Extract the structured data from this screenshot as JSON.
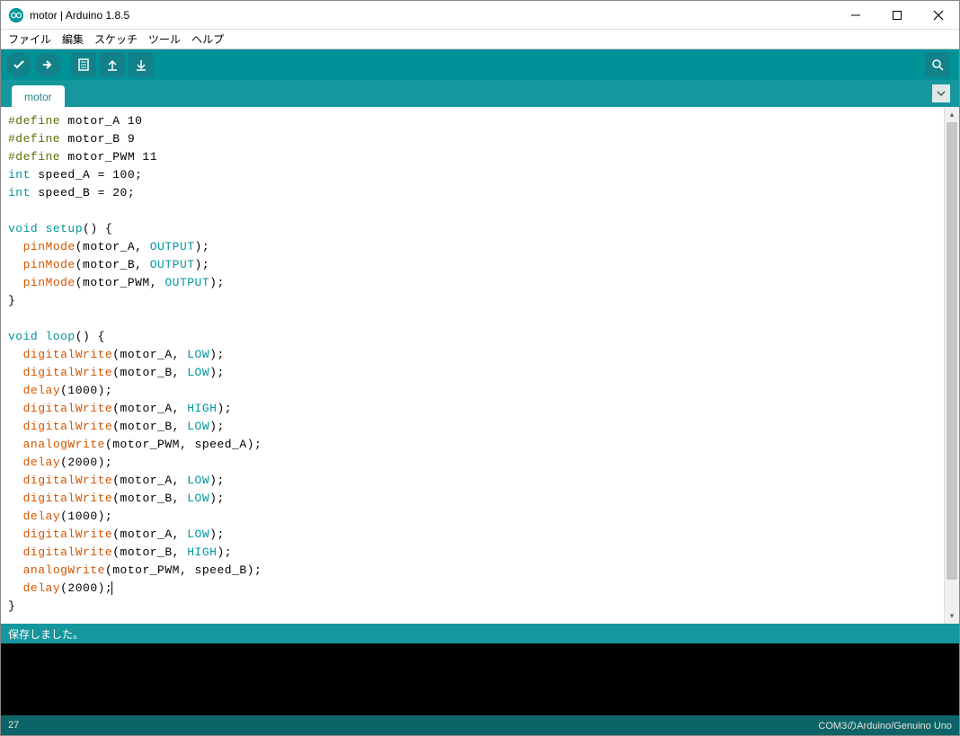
{
  "window": {
    "title": "motor | Arduino 1.8.5"
  },
  "menu": {
    "file": "ファイル",
    "edit": "編集",
    "sketch": "スケッチ",
    "tools": "ツール",
    "help": "ヘルプ"
  },
  "tab": {
    "name": "motor"
  },
  "status": {
    "text": "保存しました。"
  },
  "footer": {
    "left": "27",
    "right": "COM3のArduino/Genuino Uno"
  },
  "code": {
    "lines": [
      [
        [
          "kw-preproc",
          "#define"
        ],
        [
          "plain",
          " motor_A 10"
        ]
      ],
      [
        [
          "kw-preproc",
          "#define"
        ],
        [
          "plain",
          " motor_B 9"
        ]
      ],
      [
        [
          "kw-preproc",
          "#define"
        ],
        [
          "plain",
          " motor_PWM 11"
        ]
      ],
      [
        [
          "kw-type",
          "int"
        ],
        [
          "plain",
          " speed_A = 100;"
        ]
      ],
      [
        [
          "kw-type",
          "int"
        ],
        [
          "plain",
          " speed_B = 20;"
        ]
      ],
      [
        [
          "plain",
          ""
        ]
      ],
      [
        [
          "kw-type",
          "void"
        ],
        [
          "plain",
          " "
        ],
        [
          "kw-const",
          "setup"
        ],
        [
          "plain",
          "() {"
        ]
      ],
      [
        [
          "plain",
          "  "
        ],
        [
          "kw-func",
          "pinMode"
        ],
        [
          "plain",
          "(motor_A, "
        ],
        [
          "kw-const",
          "OUTPUT"
        ],
        [
          "plain",
          ");"
        ]
      ],
      [
        [
          "plain",
          "  "
        ],
        [
          "kw-func",
          "pinMode"
        ],
        [
          "plain",
          "(motor_B, "
        ],
        [
          "kw-const",
          "OUTPUT"
        ],
        [
          "plain",
          ");"
        ]
      ],
      [
        [
          "plain",
          "  "
        ],
        [
          "kw-func",
          "pinMode"
        ],
        [
          "plain",
          "(motor_PWM, "
        ],
        [
          "kw-const",
          "OUTPUT"
        ],
        [
          "plain",
          ");"
        ]
      ],
      [
        [
          "plain",
          "}"
        ]
      ],
      [
        [
          "plain",
          ""
        ]
      ],
      [
        [
          "kw-type",
          "void"
        ],
        [
          "plain",
          " "
        ],
        [
          "kw-const",
          "loop"
        ],
        [
          "plain",
          "() {"
        ]
      ],
      [
        [
          "plain",
          "  "
        ],
        [
          "kw-func",
          "digitalWrite"
        ],
        [
          "plain",
          "(motor_A, "
        ],
        [
          "kw-const",
          "LOW"
        ],
        [
          "plain",
          ");"
        ]
      ],
      [
        [
          "plain",
          "  "
        ],
        [
          "kw-func",
          "digitalWrite"
        ],
        [
          "plain",
          "(motor_B, "
        ],
        [
          "kw-const",
          "LOW"
        ],
        [
          "plain",
          ");"
        ]
      ],
      [
        [
          "plain",
          "  "
        ],
        [
          "kw-func",
          "delay"
        ],
        [
          "plain",
          "(1000);"
        ]
      ],
      [
        [
          "plain",
          "  "
        ],
        [
          "kw-func",
          "digitalWrite"
        ],
        [
          "plain",
          "(motor_A, "
        ],
        [
          "kw-const",
          "HIGH"
        ],
        [
          "plain",
          ");"
        ]
      ],
      [
        [
          "plain",
          "  "
        ],
        [
          "kw-func",
          "digitalWrite"
        ],
        [
          "plain",
          "(motor_B, "
        ],
        [
          "kw-const",
          "LOW"
        ],
        [
          "plain",
          ");"
        ]
      ],
      [
        [
          "plain",
          "  "
        ],
        [
          "kw-func",
          "analogWrite"
        ],
        [
          "plain",
          "(motor_PWM, speed_A);"
        ]
      ],
      [
        [
          "plain",
          "  "
        ],
        [
          "kw-func",
          "delay"
        ],
        [
          "plain",
          "(2000);"
        ]
      ],
      [
        [
          "plain",
          "  "
        ],
        [
          "kw-func",
          "digitalWrite"
        ],
        [
          "plain",
          "(motor_A, "
        ],
        [
          "kw-const",
          "LOW"
        ],
        [
          "plain",
          ");"
        ]
      ],
      [
        [
          "plain",
          "  "
        ],
        [
          "kw-func",
          "digitalWrite"
        ],
        [
          "plain",
          "(motor_B, "
        ],
        [
          "kw-const",
          "LOW"
        ],
        [
          "plain",
          ");"
        ]
      ],
      [
        [
          "plain",
          "  "
        ],
        [
          "kw-func",
          "delay"
        ],
        [
          "plain",
          "(1000);"
        ]
      ],
      [
        [
          "plain",
          "  "
        ],
        [
          "kw-func",
          "digitalWrite"
        ],
        [
          "plain",
          "(motor_A, "
        ],
        [
          "kw-const",
          "LOW"
        ],
        [
          "plain",
          ");"
        ]
      ],
      [
        [
          "plain",
          "  "
        ],
        [
          "kw-func",
          "digitalWrite"
        ],
        [
          "plain",
          "(motor_B, "
        ],
        [
          "kw-const",
          "HIGH"
        ],
        [
          "plain",
          ");"
        ]
      ],
      [
        [
          "plain",
          "  "
        ],
        [
          "kw-func",
          "analogWrite"
        ],
        [
          "plain",
          "(motor_PWM, speed_B);"
        ]
      ],
      [
        [
          "plain",
          "  "
        ],
        [
          "kw-func",
          "delay"
        ],
        [
          "plain",
          "(2000);"
        ],
        [
          "cursor",
          ""
        ]
      ],
      [
        [
          "plain",
          "}"
        ]
      ]
    ]
  }
}
